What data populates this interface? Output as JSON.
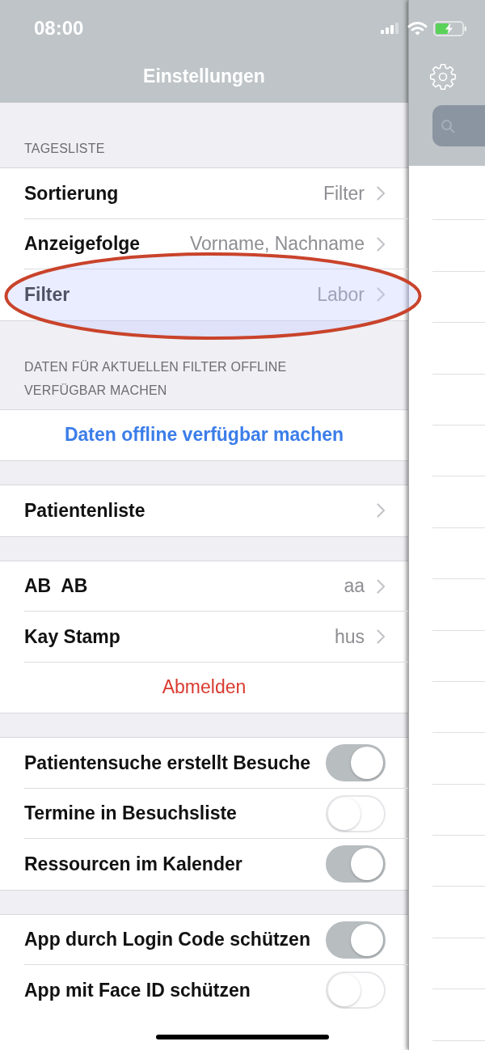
{
  "status_bar": {
    "time": "08:00"
  },
  "navigation_bar": {
    "title": "Einstellungen"
  },
  "groups": [
    {
      "header": "TAGESLISTE",
      "rows": [
        {
          "kind": "detail",
          "label": "Sortierung",
          "value": "Filter",
          "highlighted": false
        },
        {
          "kind": "detail",
          "label": "Anzeigefolge",
          "value": "Vorname, Nachname",
          "highlighted": false
        },
        {
          "kind": "detail",
          "label": "Filter",
          "value": "Labor",
          "highlighted": true
        }
      ]
    },
    {
      "header": "DATEN FÜR AKTUELLEN FILTER OFFLINE VERFÜGBAR MACHEN",
      "rows": [
        {
          "kind": "action",
          "label": "Daten offline verfügbar machen",
          "highlighted": false
        }
      ]
    },
    {
      "rows": [
        {
          "kind": "detail",
          "label": "Patientenliste",
          "highlighted": false
        }
      ]
    },
    {
      "rows": [
        {
          "kind": "detail",
          "label": "AB  AB",
          "value": "aa",
          "highlighted": false
        },
        {
          "kind": "detail",
          "label": "Kay Stamp",
          "value": "hus",
          "highlighted": false
        },
        {
          "kind": "destructive",
          "label": "Abmelden",
          "highlighted": false
        }
      ]
    },
    {
      "rows": [
        {
          "kind": "toggle",
          "label": "Patientensuche erstellt Besuche",
          "on": true,
          "highlighted": false
        },
        {
          "kind": "toggle",
          "label": "Termine in Besuchsliste",
          "on": false,
          "highlighted": false
        },
        {
          "kind": "toggle",
          "label": "Ressourcen im Kalender",
          "on": true,
          "highlighted": false
        }
      ]
    },
    {
      "rows": [
        {
          "kind": "toggle",
          "label": "App durch Login Code schützen",
          "on": true,
          "highlighted": false
        },
        {
          "kind": "toggle",
          "label": "App mit Face ID schützen",
          "on": false,
          "highlighted": false
        }
      ]
    }
  ]
}
